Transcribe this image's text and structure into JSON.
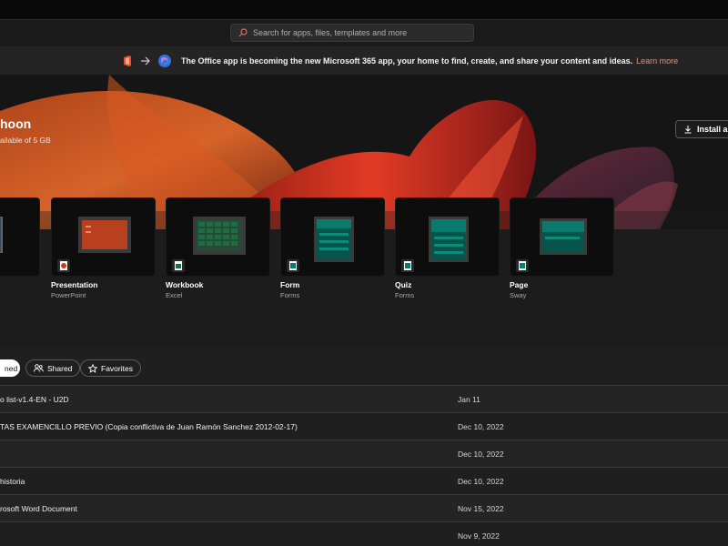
{
  "search": {
    "placeholder": "Search for apps, files, templates and more"
  },
  "banner": {
    "message": "The Office app is becoming the new Microsoft 365 app, your home to find, create, and share your content and ideas.",
    "link": "Learn more"
  },
  "hero": {
    "greeting": "hoon",
    "storage": "ailable of 5 GB",
    "install_label": "Install ap"
  },
  "templates": [
    {
      "label": "",
      "app": ""
    },
    {
      "label": "Presentation",
      "app": "PowerPoint"
    },
    {
      "label": "Workbook",
      "app": "Excel"
    },
    {
      "label": "Form",
      "app": "Forms"
    },
    {
      "label": "Quiz",
      "app": "Forms"
    },
    {
      "label": "Page",
      "app": "Sway"
    }
  ],
  "filters": {
    "opened": "ned",
    "shared": "Shared",
    "favorites": "Favorites"
  },
  "files": [
    {
      "name": "o list-v1.4-EN - U2D",
      "date": "Jan 11"
    },
    {
      "name": "TAS EXAMENCILLO PREVIO (Copia conflictiva de Juan Ramón Sanchez 2012-02-17)",
      "date": "Dec 10, 2022"
    },
    {
      "name": "",
      "date": "Dec 10, 2022"
    },
    {
      "name": "historia",
      "date": "Dec 10, 2022"
    },
    {
      "name": "rosoft Word Document",
      "date": "Nov 15, 2022"
    },
    {
      "name": "",
      "date": "Nov 9, 2022"
    }
  ],
  "colors": {
    "accent": "#f08c7a",
    "powerpoint": "#c43e1c",
    "excel": "#1d6f42",
    "forms": "#037c6e",
    "sway": "#008272"
  }
}
